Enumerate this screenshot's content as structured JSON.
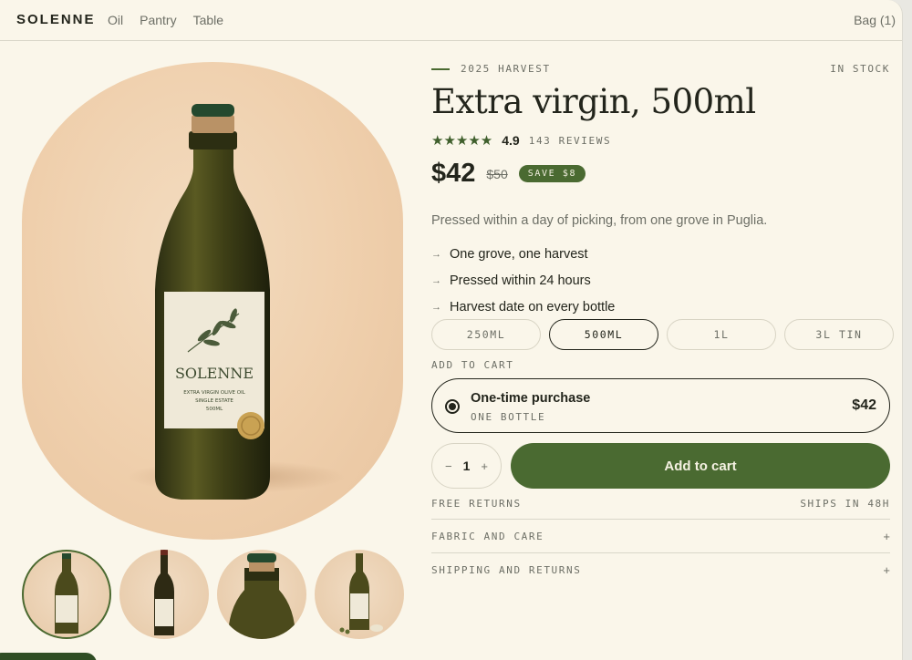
{
  "header": {
    "brand": "SOLENNE",
    "nav": [
      "Oil",
      "Pantry",
      "Table"
    ],
    "bag": "Bag (1)"
  },
  "product": {
    "eyebrow": "2025 HARVEST",
    "stock": "IN STOCK",
    "title": "Extra virgin, 500ml",
    "stars": "★★★★★",
    "rating": "4.9",
    "reviews": "143 REVIEWS",
    "price": "$42",
    "old_price": "$50",
    "save": "SAVE $8",
    "description": "Pressed within a day of picking, from one grove in Puglia.",
    "features": [
      "One grove, one harvest",
      "Pressed within 24 hours",
      "Harvest date on every bottle"
    ],
    "feature_arrow": "→",
    "sizes": [
      "250ml",
      "500ml",
      "1L",
      "3L tin"
    ],
    "selected_size": "500ml",
    "label": {
      "brand": "SOLENNE",
      "line1": "EXTRA VIRGIN OLIVE OIL",
      "line2": "SINGLE ESTATE",
      "line3": "500ML"
    }
  },
  "add_to_cart": {
    "label": "ADD TO CART",
    "option_title": "One-time purchase",
    "option_sub": "ONE BOTTLE",
    "option_price": "$42",
    "qty_minus": "−",
    "qty_value": "1",
    "qty_plus": "+",
    "button": "Add to cart",
    "free_returns": "FREE RETURNS",
    "ships": "SHIPS IN 48H"
  },
  "accordions": [
    {
      "label": "FABRIC AND CARE",
      "icon": "+"
    },
    {
      "label": "SHIPPING AND RETURNS",
      "icon": "+"
    }
  ],
  "colors": {
    "accent": "#4a6a31",
    "background": "#faf6ea",
    "text": "#23251c",
    "muted": "#6d6f66"
  }
}
